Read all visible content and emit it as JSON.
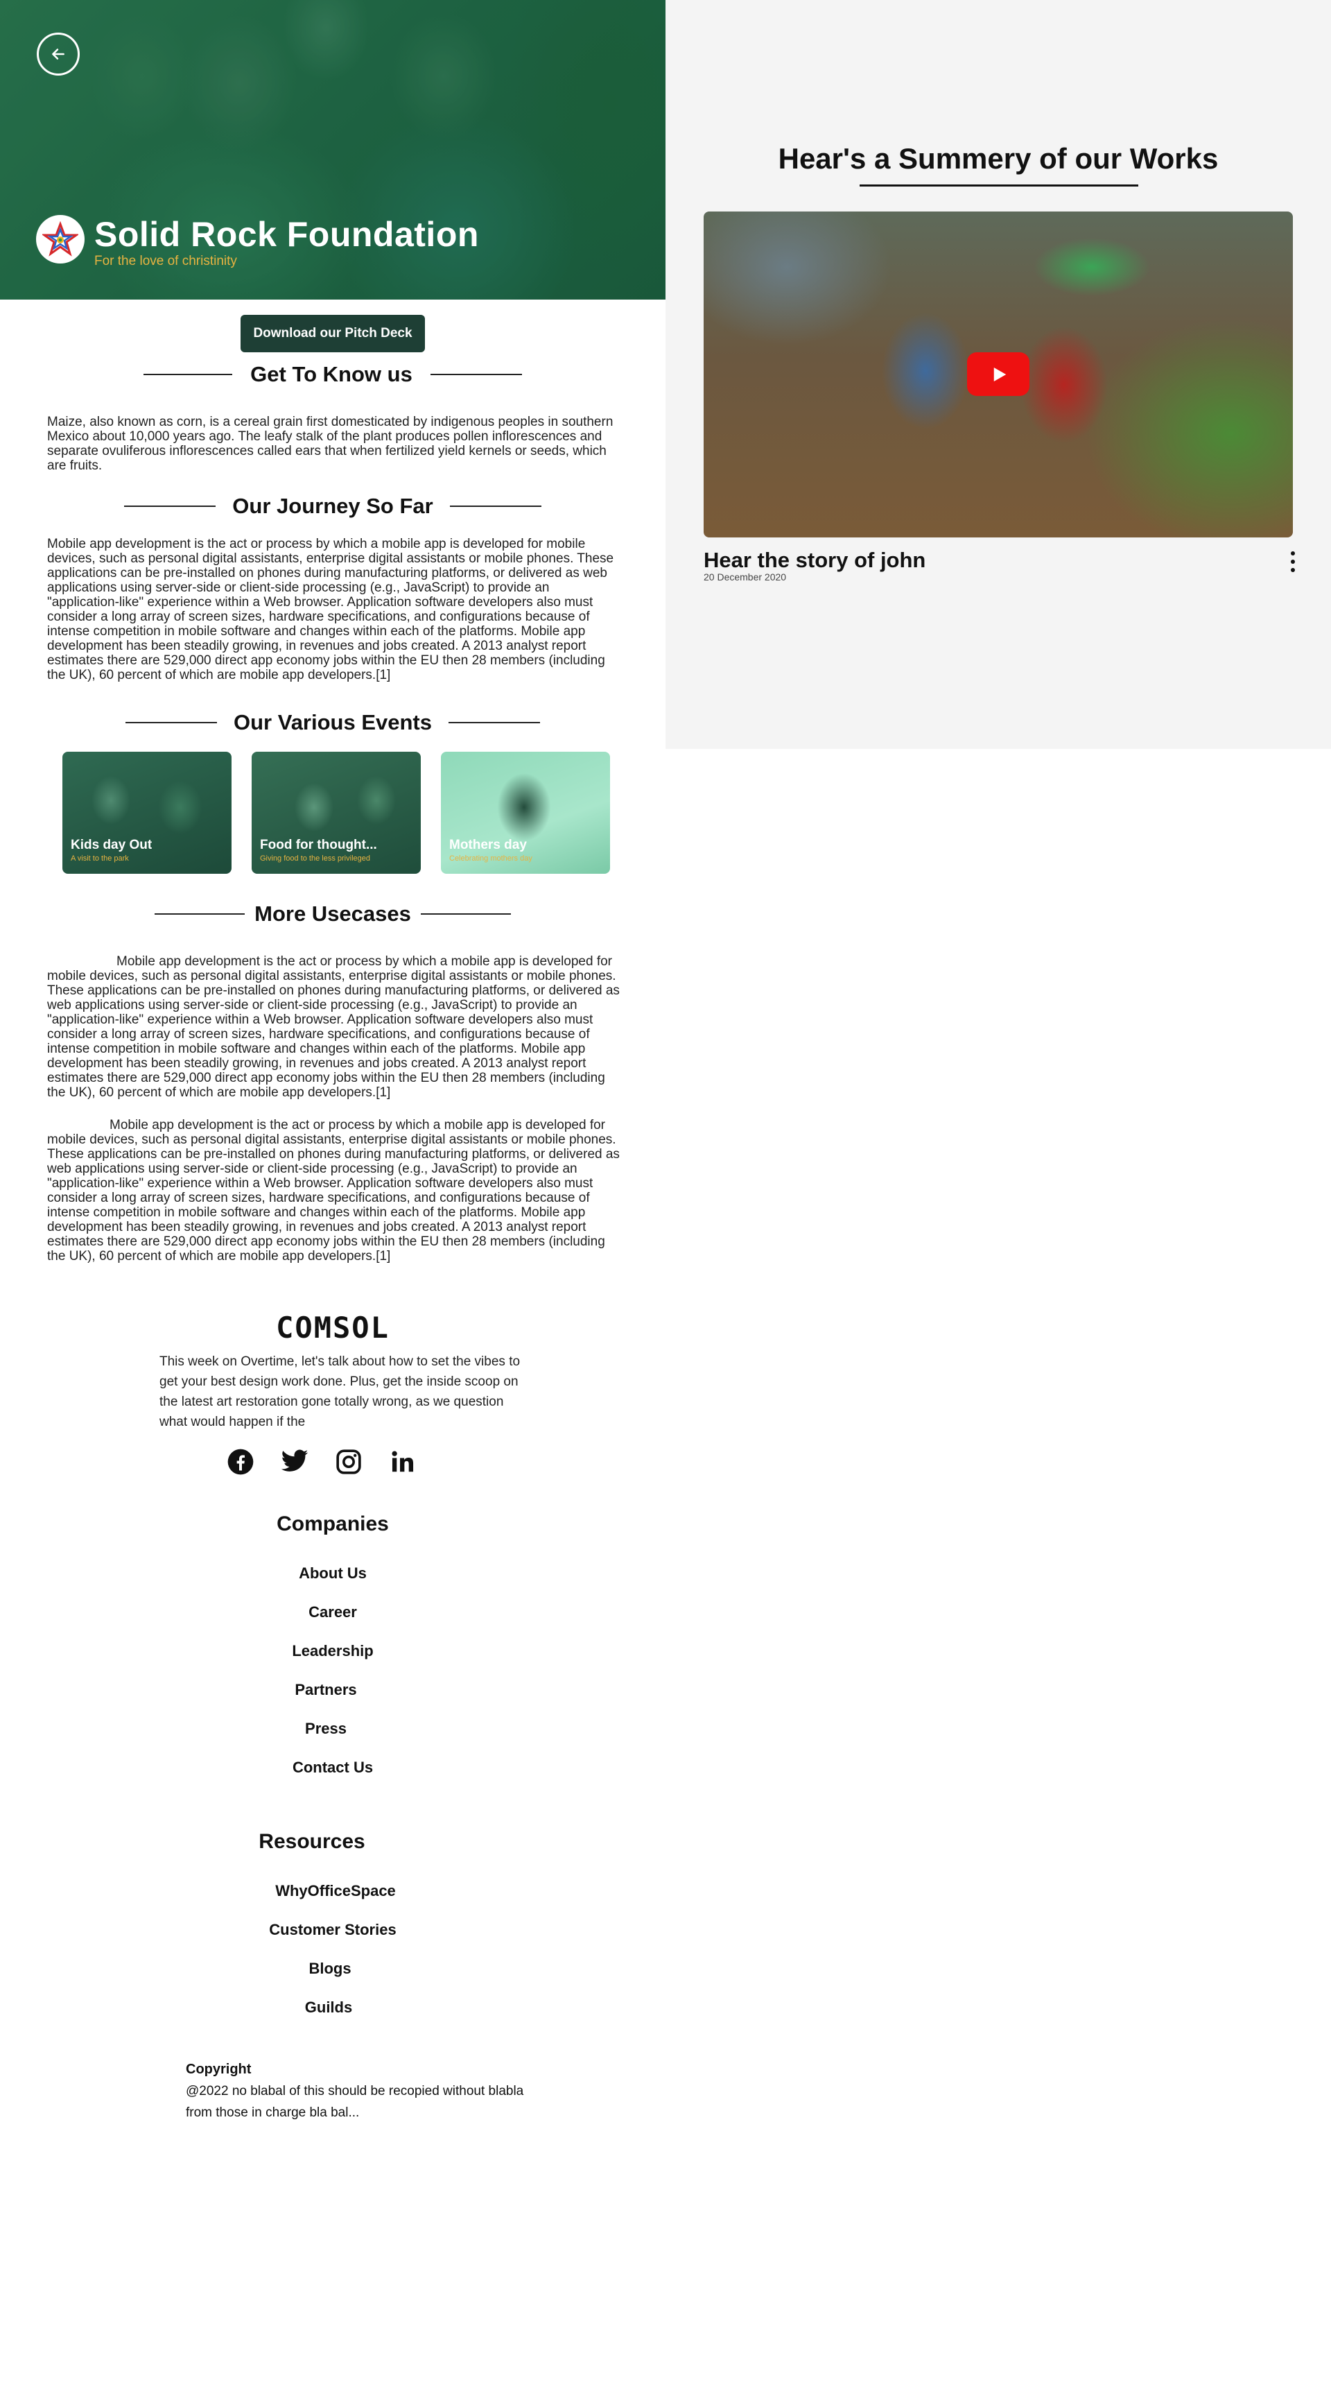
{
  "hero": {
    "org_name": "Solid Rock Foundation",
    "tagline": "For the love of christinity",
    "back_icon": "arrow-left-icon",
    "logo_icon": "star-logo-icon"
  },
  "pitch_button": "Download our Pitch Deck",
  "sections": {
    "know_us": {
      "heading": "Get To Know us",
      "text": "Maize, also known as corn, is a cereal grain first domesticated by indigenous peoples in southern Mexico about 10,000 years ago. The leafy stalk of the plant produces pollen inflorescences and separate ovuliferous inflorescences called ears that when fertilized yield kernels or seeds, which are fruits."
    },
    "journey": {
      "heading": "Our Journey So Far",
      "text": "Mobile app development is the act or process by which a mobile app is developed for mobile devices, such as personal digital assistants, enterprise digital assistants or mobile phones. These applications can be pre-installed on phones during manufacturing platforms, or delivered as web applications using server-side or client-side processing (e.g., JavaScript) to provide an \"application-like\" experience within a Web browser. Application software developers also must consider a long array of screen sizes, hardware specifications, and configurations because of intense competition in mobile software and changes within each of the platforms. Mobile app development has been steadily growing, in revenues and jobs created. A 2013 analyst report estimates there are 529,000 direct app economy jobs within the EU then 28 members (including the UK), 60 percent of which are mobile app developers.[1]"
    },
    "events": {
      "heading": "Our Various Events",
      "items": [
        {
          "title": "Kids day Out",
          "subtitle": "A visit to the park"
        },
        {
          "title": "Food for thought...",
          "subtitle": "Giving food to the less privileged"
        },
        {
          "title": "Mothers day",
          "subtitle": "Celebrating mothers day"
        }
      ]
    },
    "usecases": {
      "heading": "More Usecases",
      "paragraphs": [
        "Mobile app development is the act or process by which a mobile app is developed for mobile devices, such as personal digital assistants, enterprise digital assistants or mobile phones. These applications can be pre-installed on phones during manufacturing platforms, or delivered as web applications using server-side or client-side processing (e.g., JavaScript) to provide an \"application-like\" experience within a Web browser. Application software developers also must consider a long array of screen sizes, hardware specifications, and configurations because of intense competition in mobile software and changes within each of the platforms. Mobile app development has been steadily growing, in revenues and jobs created. A 2013 analyst report estimates there are 529,000 direct app economy jobs within the EU then 28 members (including the UK), 60 percent of which are mobile app developers.[1]",
        "Mobile app development is the act or process by which a mobile app is developed for mobile devices, such as personal digital assistants, enterprise digital assistants or mobile phones. These applications can be pre-installed on phones during manufacturing platforms, or delivered as web applications using server-side or client-side processing (e.g., JavaScript) to provide an \"application-like\" experience within a Web browser. Application software developers also must consider a long array of screen sizes, hardware specifications, and configurations because of intense competition in mobile software and changes within each of the platforms. Mobile app development has been steadily growing, in revenues and jobs created. A 2013 analyst report estimates there are 529,000 direct app economy jobs within the EU then 28 members (including the UK), 60 percent of which are mobile app developers.[1]"
      ]
    }
  },
  "footer": {
    "brand": "COMSOL",
    "blurb": "This week on Overtime, let's talk about how to set the vibes to get your best design work done. Plus, get the inside scoop on the latest art restoration gone totally wrong, as we question what would happen if the",
    "social_icons": [
      "facebook-icon",
      "twitter-icon",
      "instagram-icon",
      "linkedin-icon"
    ],
    "companies": {
      "heading": "Companies",
      "links": [
        "About Us",
        "Career",
        "Leadership",
        "Partners",
        "Press",
        "Contact Us"
      ]
    },
    "resources": {
      "heading": "Resources",
      "links": [
        "WhyOfficeSpace",
        "Customer Stories",
        "Blogs",
        "Guilds"
      ]
    },
    "copyright_heading": "Copyright",
    "copyright_text": "@2022 no blabal of this should be recopied without blabla from those in charge bla bal..."
  },
  "works": {
    "heading": "Hear's a Summery of our Works",
    "video_title": "Hear the story of john",
    "video_date": "20 December 2020",
    "play_icon": "play-icon",
    "menu_icon": "more-vertical-icon"
  },
  "colors": {
    "pitch_button": "#1e3f35",
    "tagline": "#e8b341",
    "play_button": "#ee1111",
    "right_panel": "#f4f4f4"
  }
}
